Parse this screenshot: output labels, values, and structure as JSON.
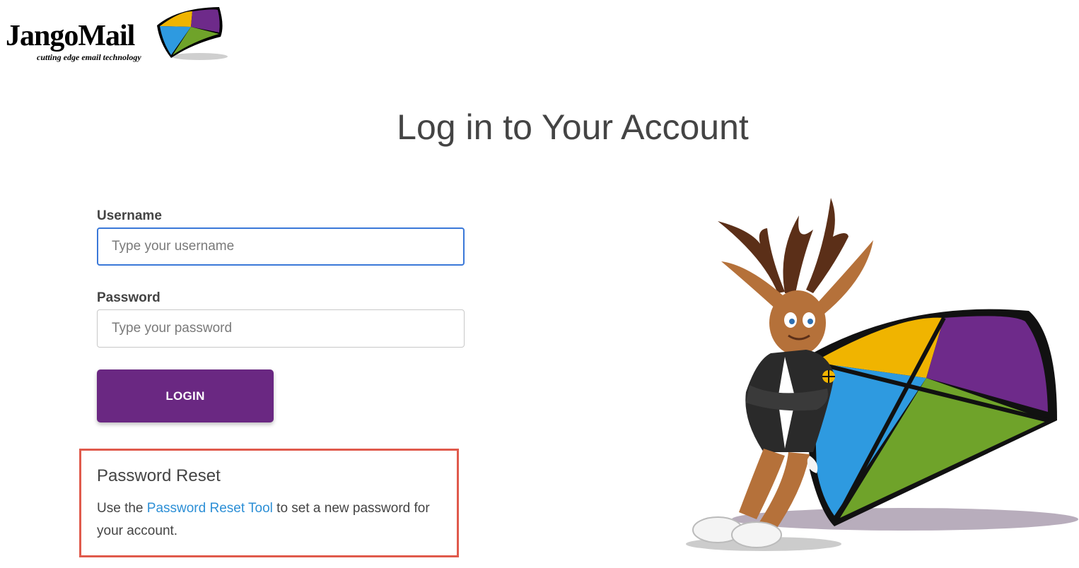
{
  "logo": {
    "wordmark": "JangoMail",
    "tagline": "cutting edge email technology"
  },
  "title": "Log in to Your Account",
  "form": {
    "username_label": "Username",
    "username_placeholder": "Type your username",
    "password_label": "Password",
    "password_placeholder": "Type your password",
    "login_label": "LOGIN"
  },
  "reset": {
    "title": "Password Reset",
    "text_before": "Use the ",
    "link": "Password Reset Tool",
    "text_after": " to set a new password for your account."
  },
  "colors": {
    "accent_button": "#6a2882",
    "link": "#2c8fd6",
    "highlight_border": "#e05a4c",
    "focus_border": "#3a78d8",
    "kite_yellow": "#f0b400",
    "kite_purple": "#6e2a8a",
    "kite_blue": "#2e9ae0",
    "kite_green": "#6fa32a"
  }
}
